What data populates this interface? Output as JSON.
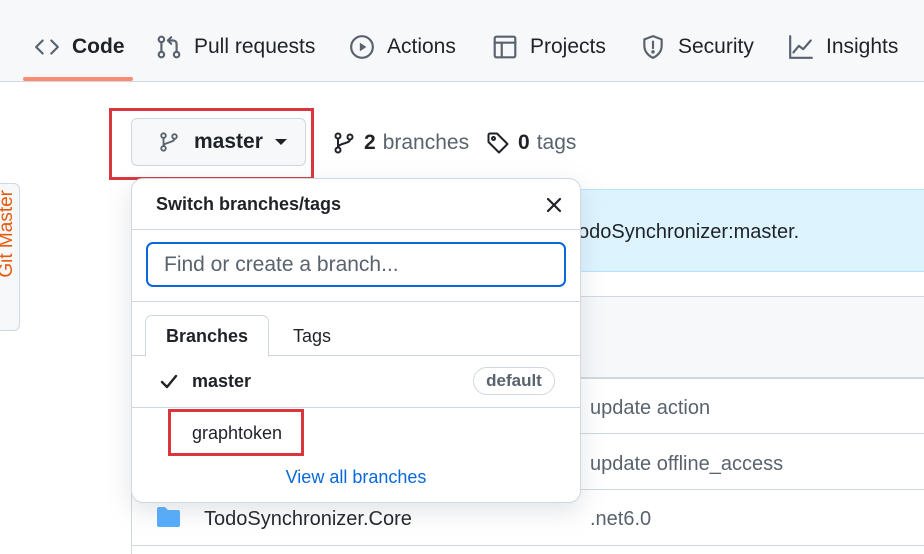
{
  "nav": {
    "tabs": [
      {
        "label": "Code",
        "icon": "code-icon",
        "active": true
      },
      {
        "label": "Pull requests",
        "icon": "pull-request-icon"
      },
      {
        "label": "Actions",
        "icon": "play-circle-icon"
      },
      {
        "label": "Projects",
        "icon": "table-icon"
      },
      {
        "label": "Security",
        "icon": "shield-icon"
      },
      {
        "label": "Insights",
        "icon": "graph-icon"
      }
    ],
    "active_underline_color": "#fd8c73"
  },
  "side_tab": {
    "label": "Git Master",
    "color": "#e8590c"
  },
  "branch_selector": {
    "label": "master",
    "icon": "git-branch-icon"
  },
  "repo_meta": {
    "branches_count": "2",
    "branches_label": "branches",
    "tags_count": "0",
    "tags_label": "tags"
  },
  "background": {
    "fork_text_fragment": "odoSynchronizer:master.",
    "commit_messages": [
      "update action",
      "update offline_access"
    ],
    "folder_name": "TodoSynchronizer.Core",
    "folder_commit": ".net6.0"
  },
  "dropdown": {
    "title": "Switch branches/tags",
    "search_placeholder": "Find or create a branch...",
    "tabs": [
      "Branches",
      "Tags"
    ],
    "branches": [
      {
        "name": "master",
        "selected": true,
        "badge": "default"
      },
      {
        "name": "graphtoken",
        "selected": false
      }
    ],
    "view_all_label": "View all branches"
  },
  "colors": {
    "highlight_box": "#d9363e",
    "focus_border": "#0969da",
    "link": "#0969da",
    "folder": "#54aeff"
  }
}
